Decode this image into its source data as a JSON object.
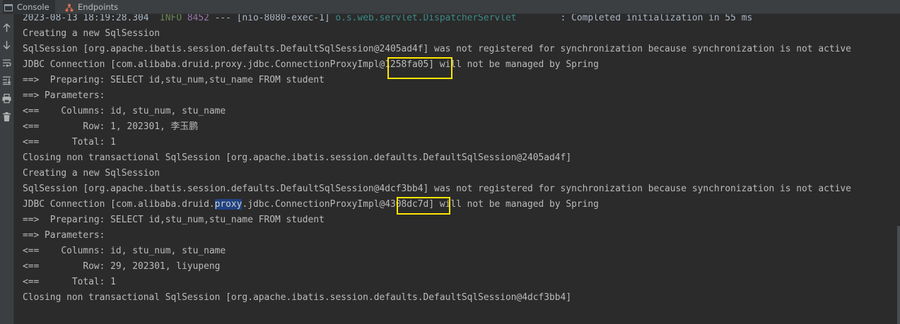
{
  "tabs": [
    {
      "label": "Console",
      "icon": "console-icon",
      "active": true
    },
    {
      "label": "Endpoints",
      "icon": "endpoints-icon",
      "active": false
    }
  ],
  "toolbar_icons": [
    "arrow-up-icon",
    "arrow-down-icon",
    "soft-wrap-icon",
    "scroll-to-end-icon",
    "print-icon",
    "clear-trash-icon"
  ],
  "colors": {
    "background": "#2b2b2b",
    "text": "#bbbbbb",
    "info_level": "#6a8759",
    "pid": "#9876aa",
    "logger": "#3d8b8b",
    "selection": "#214283",
    "highlight_box": "#ffe600"
  },
  "console": {
    "header_line": {
      "timestamp": "2023-08-13 18:19:28.304",
      "level": "INFO",
      "pid": "8452",
      "thread": " --- [nio-8080-exec-1] ",
      "logger": "o.s.web.servlet.DispatcherServlet",
      "message": "        : Completed initialization in 55 ms"
    },
    "lines": [
      "Creating a new SqlSession",
      "SqlSession [org.apache.ibatis.session.defaults.DefaultSqlSession@2405ad4f] was not registered for synchronization because synchronization is not active",
      "JDBC Connection [com.alibaba.druid.proxy.jdbc.ConnectionProxyImpl@1258fa05] will not be managed by Spring",
      "==>  Preparing: SELECT id,stu_num,stu_name FROM student",
      "==> Parameters: ",
      "<==    Columns: id, stu_num, stu_name",
      "<==        Row: 1, 202301, 李玉鹏",
      "<==      Total: 1",
      "Closing non transactional SqlSession [org.apache.ibatis.session.defaults.DefaultSqlSession@2405ad4f]",
      "Creating a new SqlSession",
      "SqlSession [org.apache.ibatis.session.defaults.DefaultSqlSession@4dcf3bb4] was not registered for synchronization because synchronization is not active",
      {
        "before": "JDBC Connection [com.alibaba.druid.",
        "selected": "proxy",
        "after": ".jdbc.ConnectionProxyImpl@4308dc7d] will not be managed by Spring"
      },
      "==>  Preparing: SELECT id,stu_num,stu_name FROM student",
      "==> Parameters: ",
      "<==    Columns: id, stu_num, stu_name",
      "<==        Row: 29, 202301, liyupeng",
      "<==      Total: 1",
      "Closing non transactional SqlSession [org.apache.ibatis.session.defaults.DefaultSqlSession@4dcf3bb4]"
    ]
  }
}
